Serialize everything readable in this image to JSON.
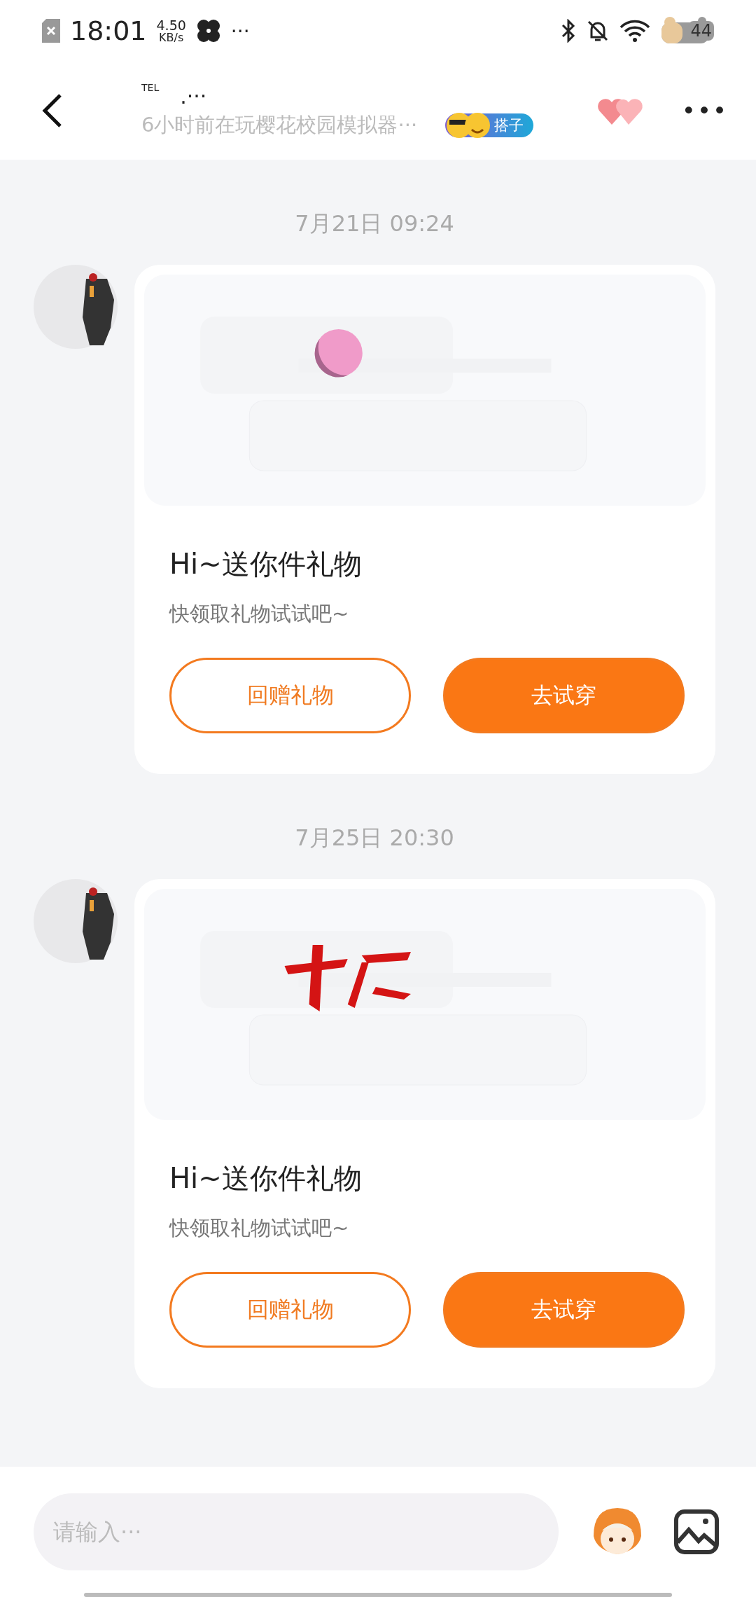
{
  "status_bar": {
    "time": "18:01",
    "speed_value": "4.50",
    "speed_unit": "KB/s",
    "more": "···",
    "battery": "44"
  },
  "header": {
    "tag": "TEL",
    "name": ".···",
    "subtitle": "6小时前在玩樱花校园模拟器···",
    "badge": "搭子",
    "more": "•••"
  },
  "messages": [
    {
      "time": "7月21日 09:24",
      "title": "Hi~送你件礼物",
      "subtitle": "快领取礼物试试吧~",
      "buttons": [
        {
          "label": "回赠礼物",
          "kind": "outline"
        },
        {
          "label": "去试穿",
          "kind": "filled"
        }
      ]
    },
    {
      "time": "7月25日 20:30",
      "title": "Hi~送你件礼物",
      "subtitle": "快领取礼物试试吧~",
      "buttons": [
        {
          "label": "回赠礼物",
          "kind": "outline"
        },
        {
          "label": "去试穿",
          "kind": "filled"
        }
      ]
    }
  ],
  "input": {
    "placeholder": "请输入···"
  }
}
